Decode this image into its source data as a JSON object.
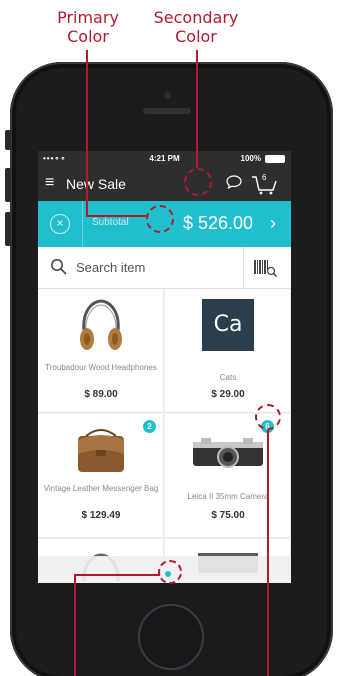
{
  "annotations": {
    "primary_color_label": "Primary\nColor",
    "secondary_color_label": "Secondary\nColor",
    "line_color": "#b01c2e"
  },
  "status_bar": {
    "signal": "•••∘∘",
    "time": "4:21 PM",
    "battery": "100%"
  },
  "title_bar": {
    "menu_icon": "hamburger-icon",
    "title": "New Sale",
    "chat_icon": "chat-icon",
    "cart_icon": "cart-icon",
    "cart_count": "6"
  },
  "subtotal": {
    "label": "Subtotal",
    "amount": "$ 526.00",
    "close_icon": "close-icon",
    "chevron": "›"
  },
  "search": {
    "placeholder": "Search item",
    "barcode_icon": "barcode-search-icon"
  },
  "products": [
    {
      "name": "Troubadour Wood Headphones",
      "price": "$ 89.00",
      "badge": null
    },
    {
      "name": "Cats",
      "price": "$ 29.00",
      "badge": null,
      "tile_text": "Ca"
    },
    {
      "name": "Vintage Leather Messenger Bag",
      "price": "$ 129.49",
      "badge": "2"
    },
    {
      "name": "Leica II 35mm Camera",
      "price": "$ 75.00",
      "badge": "6"
    }
  ],
  "colors": {
    "primary": "#2e2e2e",
    "secondary": "#21bece",
    "ca_tile": "#2a3e4e"
  }
}
